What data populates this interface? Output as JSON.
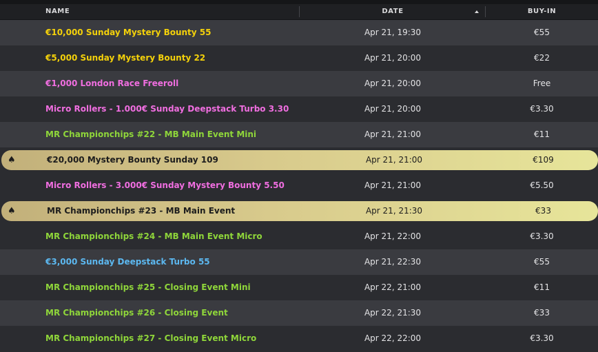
{
  "header": {
    "name": "NAME",
    "date": "DATE",
    "buyin": "BUY-IN"
  },
  "rows": [
    {
      "name": "€10,000 Sunday Mystery Bounty 55",
      "date": "Apr 21, 19:30",
      "buyin": "€55",
      "color": "#f4d10a"
    },
    {
      "name": "€5,000 Sunday Mystery Bounty 22",
      "date": "Apr 21, 20:00",
      "buyin": "€22",
      "color": "#f4d10a"
    },
    {
      "name": "€1,000 London Race Freeroll",
      "date": "Apr 21, 20:00",
      "buyin": "Free",
      "color": "#f06ee0"
    },
    {
      "name": "Micro Rollers - 1.000€ Sunday Deepstack Turbo 3.30",
      "date": "Apr 21, 20:00",
      "buyin": "€3.30",
      "color": "#f06ee0"
    },
    {
      "name": "MR Championchips #22 - MB Main Event Mini",
      "date": "Apr 21, 21:00",
      "buyin": "€11",
      "color": "#8fd63a"
    },
    {
      "name": "€20,000 Mystery Bounty Sunday 109",
      "date": "Apr 21, 21:00",
      "buyin": "€109",
      "featured": true,
      "icon": "spade-icon"
    },
    {
      "name": "Micro Rollers - 3.000€ Sunday Mystery Bounty 5.50",
      "date": "Apr 21, 21:00",
      "buyin": "€5.50",
      "color": "#f06ee0"
    },
    {
      "name": "MR Championchips #23 - MB Main Event",
      "date": "Apr 21, 21:30",
      "buyin": "€33",
      "featured": true,
      "icon": "spade-icon"
    },
    {
      "name": "MR Championchips #24 - MB Main Event Micro",
      "date": "Apr 21, 22:00",
      "buyin": "€3.30",
      "color": "#8fd63a"
    },
    {
      "name": "€3,000 Sunday Deepstack Turbo 55",
      "date": "Apr 21, 22:30",
      "buyin": "€55",
      "color": "#5cb8f0"
    },
    {
      "name": "MR Championchips #25 - Closing Event Mini",
      "date": "Apr 22, 21:00",
      "buyin": "€11",
      "color": "#8fd63a"
    },
    {
      "name": "MR Championchips #26 - Closing Event",
      "date": "Apr 22, 21:30",
      "buyin": "€33",
      "color": "#8fd63a"
    },
    {
      "name": "MR Championchips #27 - Closing Event Micro",
      "date": "Apr 22, 22:00",
      "buyin": "€3.30",
      "color": "#8fd63a"
    }
  ]
}
